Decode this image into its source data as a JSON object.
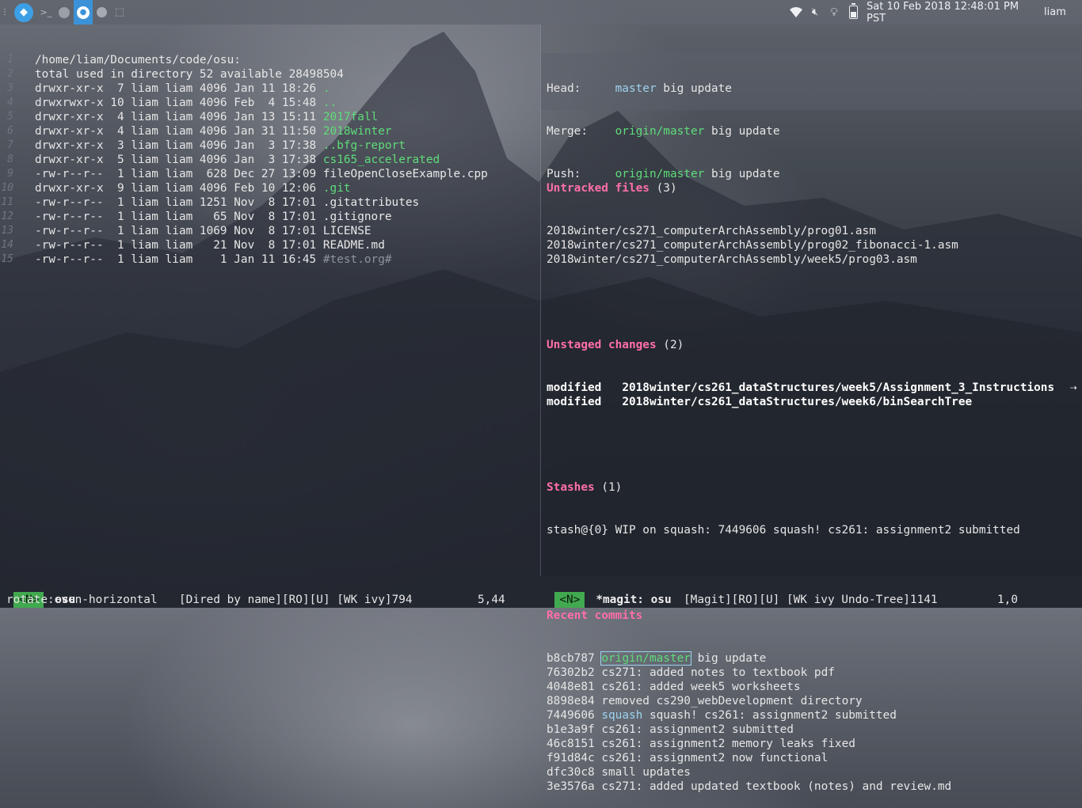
{
  "topbar": {
    "handle_glyph": "⋮",
    "term_glyph": ">_",
    "box_glyph": "⬚",
    "mute_glyph": "🔇︎",
    "bulb_glyph": "💡︎",
    "clock": "Sat 10 Feb 2018 12:48:01 PM PST",
    "user": "liam"
  },
  "left_pane": {
    "lines": [
      {
        "n": "1",
        "text": "/home/liam/Documents/code/osu:",
        "cls": "file"
      },
      {
        "n": "2",
        "text": "total used in directory 52 available 28498504",
        "cls": "file"
      },
      {
        "n": "3",
        "perm": "drwxr-xr-x  7 liam liam 4096 Jan 11 18:26 ",
        "name": ".",
        "cls": "dir"
      },
      {
        "n": "4",
        "perm": "drwxrwxr-x 10 liam liam 4096 Feb  4 15:48 ",
        "name": "..",
        "cls": "dir"
      },
      {
        "n": "5",
        "perm": "drwxr-xr-x  4 liam liam 4096 Jan 13 15:11 ",
        "name": "2017fall",
        "cls": "dir"
      },
      {
        "n": "6",
        "perm": "drwxr-xr-x  4 liam liam 4096 Jan 31 11:50 ",
        "name": "2018winter",
        "cls": "dir"
      },
      {
        "n": "7",
        "perm": "drwxr-xr-x  3 liam liam 4096 Jan  3 17:38 ",
        "name": "..bfg-report",
        "cls": "dir"
      },
      {
        "n": "8",
        "perm": "drwxr-xr-x  5 liam liam 4096 Jan  3 17:38 ",
        "name": "cs165_accelerated",
        "cls": "dir"
      },
      {
        "n": "9",
        "perm": "-rw-r--r--  1 liam liam  628 Dec 27 13:09 ",
        "name": "fileOpenCloseExample.cpp",
        "cls": "file"
      },
      {
        "n": "10",
        "perm": "drwxr-xr-x  9 liam liam 4096 Feb 10 12:06 ",
        "name": ".git",
        "cls": "dir"
      },
      {
        "n": "11",
        "perm": "-rw-r--r--  1 liam liam 1251 Nov  8 17:01 ",
        "name": ".gitattributes",
        "cls": "file"
      },
      {
        "n": "12",
        "perm": "-rw-r--r--  1 liam liam   65 Nov  8 17:01 ",
        "name": ".gitignore",
        "cls": "file"
      },
      {
        "n": "13",
        "perm": "-rw-r--r--  1 liam liam 1069 Nov  8 17:01 ",
        "name": "LICENSE",
        "cls": "file"
      },
      {
        "n": "14",
        "perm": "-rw-r--r--  1 liam liam   21 Nov  8 17:01 ",
        "name": "README.md",
        "cls": "file"
      },
      {
        "n": "15",
        "perm": "-rw-r--r--  1 liam liam    1 Jan 11 16:45 ",
        "name": "#test.org#",
        "cls": "dim"
      }
    ]
  },
  "magit": {
    "head_label": "Head:     ",
    "head_branch": "master",
    "head_msg": " big update",
    "merge_label": "Merge:    ",
    "merge_branch": "origin/master",
    "merge_msg": " big update",
    "push_label": "Push:     ",
    "push_branch": "origin/master",
    "push_msg": " big update",
    "untracked_title": "Untracked files",
    "untracked_count": " (3)",
    "untracked": [
      "2018winter/cs271_computerArchAssembly/prog01.asm",
      "2018winter/cs271_computerArchAssembly/prog02_fibonacci-1.asm",
      "2018winter/cs271_computerArchAssembly/week5/prog03.asm"
    ],
    "unstaged_title": "Unstaged changes",
    "unstaged_count": " (2)",
    "unstaged": [
      {
        "status": "modified   ",
        "path": "2018winter/cs261_dataStructures/week5/Assignment_3_Instructions"
      },
      {
        "status": "modified   ",
        "path": "2018winter/cs261_dataStructures/week6/binSearchTree"
      }
    ],
    "unstaged_overflow": "⇢",
    "stashes_title": "Stashes",
    "stashes_count": " (1)",
    "stash": "stash@{0} WIP on squash: 7449606 squash! cs261: assignment2 submitted",
    "recent_title": "Recent commits",
    "commits": [
      {
        "hash": "b8cb787",
        "ref": "origin/master",
        "msg": " big update"
      },
      {
        "hash": "76302b2",
        "ref": "",
        "msg": "cs271: added notes to textbook pdf"
      },
      {
        "hash": "4048e81",
        "ref": "",
        "msg": "cs261: added week5 worksheets"
      },
      {
        "hash": "8898e84",
        "ref": "",
        "msg": "removed cs290_webDevelopment directory"
      },
      {
        "hash": "7449606",
        "ref": "squash",
        "msg": " squash! cs261: assignment2 submitted"
      },
      {
        "hash": "b1e3a9f",
        "ref": "",
        "msg": "cs261: assignment2 submitted"
      },
      {
        "hash": "46c8151",
        "ref": "",
        "msg": "cs261: assignment2 memory leaks fixed"
      },
      {
        "hash": "f91d84c",
        "ref": "",
        "msg": "cs261: assignment2 now functional"
      },
      {
        "hash": "dfc30c8",
        "ref": "",
        "msg": "small updates"
      },
      {
        "hash": "3e3576a",
        "ref": "",
        "msg": "cs271: added updated textbook (notes) and review.md"
      }
    ]
  },
  "modeline_left": {
    "state": "<N>",
    "buffer": "osu",
    "info": "[Dired by name][RO][U] [WK ivy]794",
    "pos": "5,44"
  },
  "modeline_right": {
    "state": "<N>",
    "buffer": "*magit: osu",
    "info": "[Magit][RO][U] [WK ivy Undo-Tree]1141",
    "pos": "1,0"
  },
  "minibuffer": "rotate:even-horizontal",
  "colors": {
    "dir": "#5fdc7a",
    "section_header": "#ff6fa8",
    "branch": "#9dd3f0",
    "evil_state": "#41a94f"
  }
}
